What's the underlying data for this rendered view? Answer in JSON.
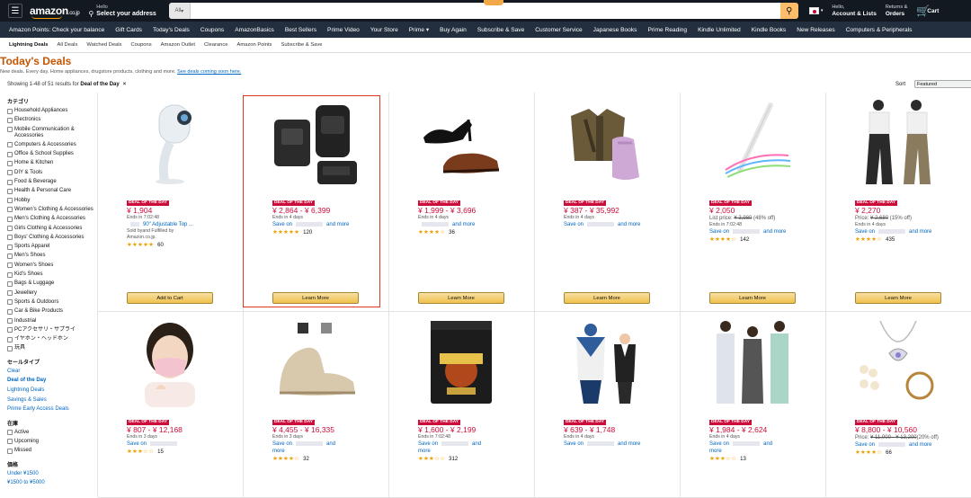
{
  "header": {
    "logo": "amazon",
    "logo_suffix": ".co.jp",
    "location_line1": "Hello",
    "location_line2": "Select your address",
    "search_category": "All",
    "search_placeholder": "",
    "account_line1": "Hello,",
    "account_line2": "Account & Lists",
    "returns_line1": "Returns &",
    "returns_line2": "Orders",
    "cart_label": "Cart"
  },
  "nav": [
    "Amazon Points: Check your balance",
    "Gift Cards",
    "Today's Deals",
    "Coupons",
    "AmazonBasics",
    "Best Sellers",
    "Prime Video",
    "Your Store",
    "Prime ▾",
    "Buy Again",
    "Subscribe & Save",
    "Customer Service",
    "Japanese Books",
    "Prime Reading",
    "Kindle Unlimited",
    "Kindle Books",
    "New Releases",
    "Computers & Peripherals"
  ],
  "subnav": [
    "Lightning Deals",
    "All Deals",
    "Watched Deals",
    "Coupons",
    "Amazon Outlet",
    "Clearance",
    "Amazon Points",
    "Subscribe & Save"
  ],
  "page": {
    "title": "Today's Deals",
    "subtitle": "New deals. Every day. Home appliances, drugstore products, clothing and more. ",
    "subtitle_link": "See deals coming soon here.",
    "results_text": "Showing 1-48 of 51 results for ",
    "results_filter": "Deal of the Day",
    "results_clear": "×",
    "sort_label": "Sort",
    "sort_value": "Featured"
  },
  "sidebar": {
    "category_heading": "カテゴリ",
    "categories": [
      "Household Appliances",
      "Electronics",
      "Mobile Communication & Accessories",
      "Computers & Accessories",
      "Office & School Supplies",
      "Home & Kitchen",
      "DIY & Tools",
      "Food & Beverage",
      "Health & Personal Care",
      "Hobby",
      "Women's Clothing & Accessories",
      "Men's Clothing & Accessories",
      "Girls Clothing & Accessories",
      "Boys' Clothing & Accessories",
      "Sports Apparel",
      "Men's Shoes",
      "Women's Shoes",
      "Kid's Shoes",
      "Bags & Luggage",
      "Jewellery",
      "Sports & Outdoors",
      "Car & Bike Products",
      "Industrial",
      "PCアクセサリ・サプライ",
      "イヤホン・ヘッドホン",
      "玩具"
    ],
    "sale_heading": "セールタイプ",
    "sale_links": [
      "Clear",
      "Deal of the Day",
      "Lightning Deals",
      "Savings & Sales",
      "Prime Early Access Deals"
    ],
    "stock_heading": "在庫",
    "stock_items": [
      "Active",
      "Upcoming",
      "Missed"
    ],
    "price_heading": "価格",
    "price_links": [
      "Under ¥1500",
      "¥1500 to ¥5000"
    ]
  },
  "colors": {
    "accent": "#c45500",
    "deal_red": "#cc0c39",
    "link": "#0066c0",
    "button": "#f0c14b",
    "highlight": "#e03a1e"
  },
  "products": [
    {
      "badge": "DEAL OF THE DAY",
      "price": "¥ 1,904",
      "list": "",
      "ends": "Ends in 7:02:48",
      "save_a": "",
      "save_b": "",
      "desc": "90\" Adjustable Top ...",
      "sold": "Sold by",
      "sold2": "and Fulfilled by",
      "sold3": "Amazon.co.jp.",
      "stars": "★★★★★",
      "rating": 4.5,
      "reviews": "60",
      "button": "Add to Cart",
      "image": "projector"
    },
    {
      "badge": "DEAL OF THE DAY",
      "price": "¥ 2,864 - ¥ 6,399",
      "list": "",
      "ends": "Ends in 4 days",
      "save_a": "Save on",
      "save_b": "and more",
      "stars": "★★★★★",
      "rating": 4.5,
      "reviews": "120",
      "button": "Learn More",
      "image": "backpacks"
    },
    {
      "badge": "DEAL OF THE DAY",
      "price": "¥ 1,999 - ¥ 3,696",
      "list": "",
      "ends": "Ends in 4 days",
      "save_a": "",
      "save_b": "and more",
      "stars": "★★★★☆",
      "rating": 4,
      "reviews": "36",
      "button": "Learn More",
      "image": "shoes"
    },
    {
      "badge": "DEAL OF THE DAY",
      "price": "¥ 387 - ¥ 35,992",
      "list": "",
      "ends": "Ends in 4 days",
      "save_a": "Save on",
      "save_b": "and more",
      "stars": "",
      "rating": 0,
      "reviews": "",
      "button": "Learn More",
      "image": "jackets"
    },
    {
      "badge": "DEAL OF THE DAY",
      "price": "¥ 2,050",
      "list_label": "List price: ",
      "list_strike": "¥ 3,980",
      "list_pct": " (48% off)",
      "ends": "Ends in 7:02:48",
      "save_a": "Save on",
      "save_b": "and more",
      "stars": "★★★★☆",
      "rating": 3.5,
      "reviews": "142",
      "button": "Learn More",
      "image": "stylus"
    },
    {
      "badge": "DEAL OF THE DAY",
      "price": "¥ 2,270",
      "list_label": "Price: ",
      "list_strike": "¥ 2,680",
      "list_pct": " (15% off)",
      "ends": "Ends in 4 days",
      "save_a": "Save on",
      "save_b": "and more",
      "stars": "★★★★☆",
      "rating": 4,
      "reviews": "435",
      "button": "Learn More",
      "image": "pants"
    },
    {
      "badge": "DEAL OF THE DAY",
      "price": "¥ 807 - ¥ 12,168",
      "list": "",
      "ends": "Ends in 3 days",
      "save_a": "Save on",
      "save_b": "",
      "stars": "★★★☆☆",
      "rating": 3,
      "reviews": "15",
      "image": "mask"
    },
    {
      "badge": "DEAL OF THE DAY",
      "price": "¥ 4,455 - ¥ 16,335",
      "list": "",
      "ends": "Ends in 3 days",
      "save_a": "Save on",
      "save_b": "and",
      "save_c": "more",
      "stars": "★★★★☆",
      "rating": 4,
      "reviews": "32",
      "image": "boots"
    },
    {
      "badge": "DEAL OF THE DAY",
      "price": "¥ 1,600 - ¥ 2,199",
      "list": "",
      "ends": "Ends in 7:02:48",
      "save_a": "Save on",
      "save_b": "and",
      "save_c": "more",
      "stars": "★★★☆☆",
      "rating": 3.5,
      "reviews": "312",
      "image": "supplement"
    },
    {
      "badge": "DEAL OF THE DAY",
      "price": "¥ 639 - ¥ 1,748",
      "list": "",
      "ends": "Ends in 4 days",
      "save_a": "Save on",
      "save_b": "and more",
      "stars": "",
      "rating": 0,
      "reviews": "",
      "image": "kidsuit"
    },
    {
      "badge": "DEAL OF THE DAY",
      "price": "¥ 1,984 - ¥ 2,624",
      "list": "",
      "ends": "Ends in 4 days",
      "save_a": "Save on",
      "save_b": "and",
      "save_c": "more",
      "stars": "★★★☆☆",
      "rating": 3,
      "reviews": "13",
      "image": "pajamas"
    },
    {
      "badge": "DEAL OF THE DAY",
      "price": "¥ 8,800 - ¥ 10,560",
      "list_label": "Price: ",
      "list_strike": "¥ 11,000 - ¥ 13,200",
      "list_pct": "(20% off)",
      "ends": "",
      "save_a": "Save on",
      "save_b": "and more",
      "stars": "★★★★☆",
      "rating": 4,
      "reviews": "66",
      "image": "jewelry"
    }
  ]
}
